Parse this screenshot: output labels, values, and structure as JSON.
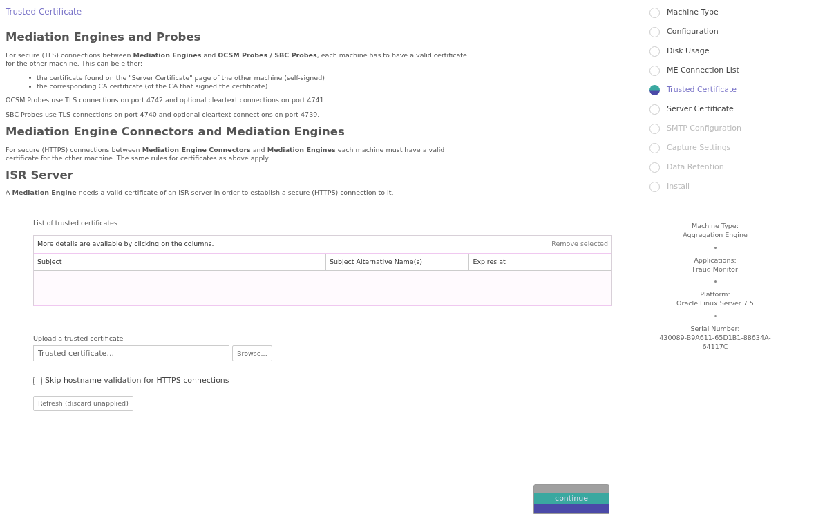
{
  "page_title": "Trusted Certificate",
  "sections": [
    {
      "heading": "Mediation Engines and Probes",
      "paragraphs": [
        "For secure (TLS) connections between **Mediation Engines** and **OCSM Probes / SBC Probes**, each machine has to have a valid certificate for the other machine. This can be either:"
      ],
      "bullets": [
        "the certificate found on the \"Server Certificate\" page of the other machine (self-signed)",
        "the corresponding CA certificate (of the CA that signed the certificate)"
      ],
      "notes": [
        "OCSM Probes use TLS connections on port 4742 and optional cleartext connections on port 4741.",
        "SBC Probes use TLS connections on port 4740 and optional cleartext connections on port 4739."
      ]
    },
    {
      "heading": "Mediation Engine Connectors and Mediation Engines",
      "paragraphs": [
        "For secure (HTTPS) connections between **Mediation Engine Connectors** and **Mediation Engines** each machine must have a valid certificate for the other machine. The same rules for certificates as above apply."
      ]
    },
    {
      "heading": "ISR Server",
      "paragraphs": [
        "A **Mediation Engine** needs a valid certificate of an ISR server in order to establish a secure (HTTPS) connection to it."
      ]
    }
  ],
  "certificates": {
    "label": "List of trusted certificates",
    "hint": "More details are available by clicking on the columns.",
    "remove_button": "Remove selected",
    "columns": [
      "Subject",
      "Subject Alternative Name(s)",
      "Expires at"
    ]
  },
  "upload": {
    "label": "Upload a trusted certificate",
    "placeholder": "Trusted certificate...",
    "browse_button": "Browse..."
  },
  "skip_hostname": {
    "label": "Skip hostname validation for HTTPS connections",
    "checked": false
  },
  "refresh_button": "Refresh (discard unapplied)",
  "continue_button": "continue",
  "steps": [
    {
      "label": "Machine Type",
      "selected": false,
      "disabled": false
    },
    {
      "label": "Configuration",
      "selected": false,
      "disabled": false
    },
    {
      "label": "Disk Usage",
      "selected": false,
      "disabled": false
    },
    {
      "label": "ME Connection List",
      "selected": false,
      "disabled": false
    },
    {
      "label": "Trusted Certificate",
      "selected": true,
      "disabled": false
    },
    {
      "label": "Server Certificate",
      "selected": false,
      "disabled": false
    },
    {
      "label": "SMTP Configuration",
      "selected": false,
      "disabled": true
    },
    {
      "label": "Capture Settings",
      "selected": false,
      "disabled": true
    },
    {
      "label": "Data Retention",
      "selected": false,
      "disabled": true
    },
    {
      "label": "Install",
      "selected": false,
      "disabled": true
    }
  ],
  "machine_info": [
    {
      "label": "Machine Type:",
      "value": "Aggregation Engine"
    },
    {
      "label": "Applications:",
      "value": "Fraud Monitor"
    },
    {
      "label": "Platform:",
      "value": "Oracle Linux Server 7.5"
    },
    {
      "label": "Serial Number:",
      "value": "430089-B9A611-65D1B1-88634A-64117C"
    }
  ]
}
